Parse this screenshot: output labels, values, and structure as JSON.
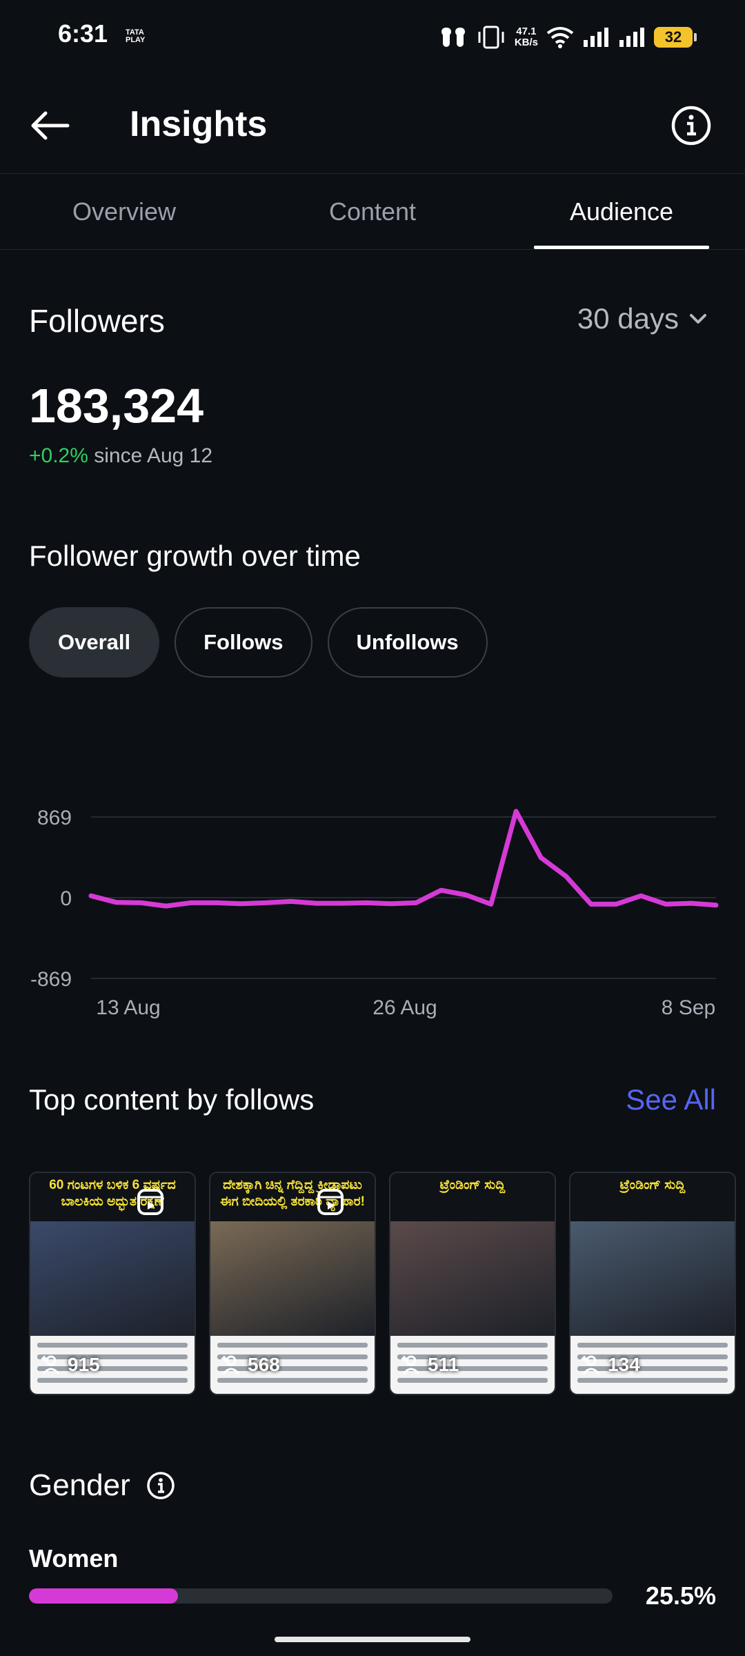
{
  "status_bar": {
    "time": "6:31",
    "carrier_line1": "TATA",
    "carrier_line2": "PLAY",
    "net_speed_value": "47.1",
    "net_speed_unit": "KB/s",
    "battery": "32",
    "icons": [
      "earbuds-icon",
      "vibrate-icon",
      "wifi-icon",
      "signal-icon",
      "signal-icon",
      "battery-icon"
    ]
  },
  "header": {
    "title": "Insights",
    "back_icon": "arrow-left-icon",
    "info_icon": "info-icon"
  },
  "tabs": [
    {
      "label": "Overview",
      "active": false
    },
    {
      "label": "Content",
      "active": false
    },
    {
      "label": "Audience",
      "active": true
    }
  ],
  "followers": {
    "title": "Followers",
    "range": "30 days",
    "count": "183,324",
    "delta": "+0.2%",
    "since": "since Aug 12"
  },
  "growth": {
    "title": "Follower growth over time",
    "chips": [
      {
        "label": "Overall",
        "active": true
      },
      {
        "label": "Follows",
        "active": false
      },
      {
        "label": "Unfollows",
        "active": false
      }
    ]
  },
  "chart_data": {
    "type": "line",
    "title": "",
    "xlabel": "",
    "ylabel": "",
    "ylim": [
      -869,
      869
    ],
    "y_ticks": [
      "869",
      "0",
      "-869"
    ],
    "x_tick_labels": [
      "13 Aug",
      "26 Aug",
      "8 Sep"
    ],
    "grid": true,
    "series": [
      {
        "color": "#d63ad6",
        "values": [
          20,
          -50,
          -55,
          -90,
          -55,
          -55,
          -65,
          -55,
          -40,
          -60,
          -60,
          -55,
          -65,
          -55,
          80,
          30,
          -70,
          930,
          430,
          230,
          -70,
          -70,
          20,
          -70,
          -60,
          -80
        ]
      }
    ]
  },
  "top_content": {
    "title": "Top content by follows",
    "see_all": "See All",
    "items": [
      {
        "follows": "915",
        "banner": "60 ಗಂಟಗಳ ಬಳಿಕ 6 ವರ್ಷದ ಬಾಲಕಿಯ ಅದ್ಭುತ ರಕ್ಷಣೆ",
        "reel": true,
        "photo": "#3b4a6b"
      },
      {
        "follows": "568",
        "banner": "ದೇಶಕ್ಕಾಗಿ ಚಿನ್ನ ಗೆದ್ದಿದ್ದ ಕ್ರೀಡಾಪಟು ಈಗ ಬೀದಿಯಲ್ಲಿ ತರಕಾರಿ ವ್ಯಾಪಾರ!",
        "reel": true,
        "photo": "#7a6a55"
      },
      {
        "follows": "511",
        "banner": "ಟ್ರೆಂಡಿಂಗ್ ಸುದ್ದಿ",
        "reel": false,
        "photo": "#5b4a4a"
      },
      {
        "follows": "134",
        "banner": "ಟ್ರೆಂಡಿಂಗ್ ಸುದ್ದಿ",
        "reel": false,
        "photo": "#4a5a6e"
      }
    ]
  },
  "gender": {
    "title": "Gender",
    "women_label": "Women",
    "women_pct": "25.5%",
    "women_fraction": 0.255,
    "bar_color": "#d63ad6"
  }
}
